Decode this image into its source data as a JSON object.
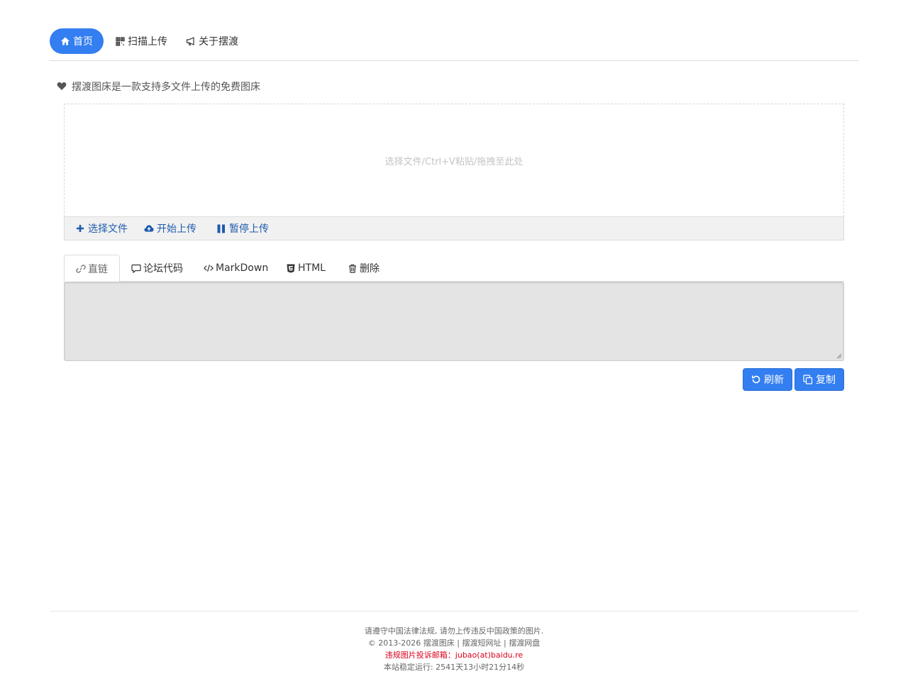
{
  "nav": {
    "items": [
      {
        "label": "首页",
        "icon": "home-icon"
      },
      {
        "label": "扫描上传",
        "icon": "qrcode-icon"
      },
      {
        "label": "关于摆渡",
        "icon": "bullhorn-icon"
      }
    ]
  },
  "intro": {
    "text": "摆渡图床是一款支持多文件上传的免费图床",
    "icon": "heart-icon"
  },
  "dropzone": {
    "placeholder": "选择文件/Ctrl+V粘贴/拖拽至此处"
  },
  "upload_bar": {
    "select_label": "选择文件",
    "start_label": "开始上传",
    "pause_label": "暂停上传"
  },
  "tabs": [
    {
      "label": "直链",
      "icon": "link-icon"
    },
    {
      "label": "论坛代码",
      "icon": "comment-icon"
    },
    {
      "label": "MarkDown",
      "icon": "code-icon"
    },
    {
      "label": "HTML",
      "icon": "html5-icon"
    },
    {
      "label": "删除",
      "icon": "trash-icon"
    }
  ],
  "actions": {
    "refresh_label": "刷新",
    "copy_label": "复制"
  },
  "footer": {
    "notice": "请遵守中国法律法规, 请勿上传违反中国政策的图片.",
    "copyright": "© 2013-2026",
    "link1": "摆渡图床",
    "sep": "|",
    "link2": "摆渡短网址",
    "link3": "摆渡网盘",
    "report": "违规图片投诉邮箱：jubao(at)baidu.re",
    "uptime": "本站稳定运行: 2541天13小时21分14秒"
  },
  "colors": {
    "accent": "#337ef0",
    "link": "#1e5cad",
    "warn": "#d9001b"
  }
}
